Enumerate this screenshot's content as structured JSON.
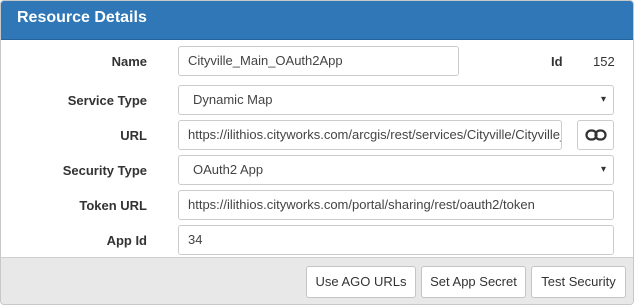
{
  "header": {
    "title": "Resource Details"
  },
  "form": {
    "name_label": "Name",
    "name_value": "Cityville_Main_OAuth2App",
    "id_label": "Id",
    "id_value": "152",
    "service_type_label": "Service Type",
    "service_type_value": "Dynamic Map",
    "url_label": "URL",
    "url_value": "https://ilithios.cityworks.com/arcgis/rest/services/Cityville/Cityville_Ma",
    "security_type_label": "Security Type",
    "security_type_value": "OAuth2 App",
    "token_url_label": "Token URL",
    "token_url_value": "https://ilithios.cityworks.com/portal/sharing/rest/oauth2/token",
    "app_id_label": "App Id",
    "app_id_value": "34"
  },
  "footer": {
    "use_ago_urls_label": "Use AGO URLs",
    "set_app_secret_label": "Set App Secret",
    "test_security_label": "Test Security"
  },
  "icons": {
    "select_caret": "▾",
    "link": "link-icon"
  },
  "colors": {
    "header_bg": "#2f77b6",
    "footer_bg": "#e8e8e8"
  }
}
